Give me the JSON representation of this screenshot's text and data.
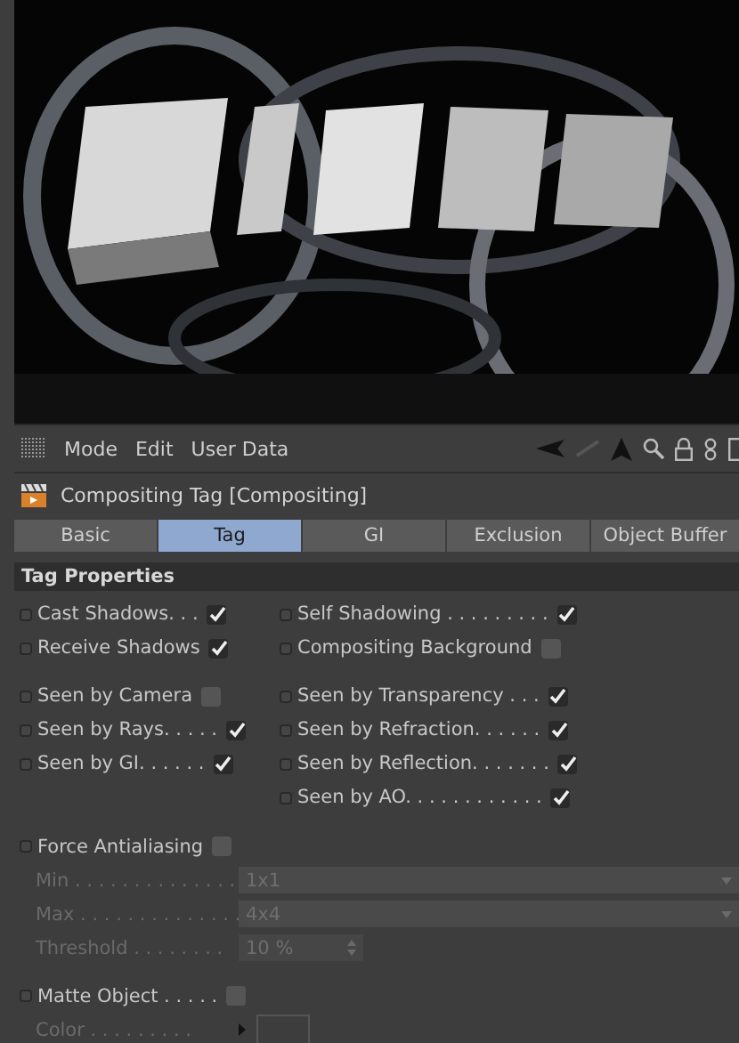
{
  "viewport": {
    "kind": "picture"
  },
  "menu": [
    "Mode",
    "Edit",
    "User Data"
  ],
  "title": "Compositing Tag [Compositing]",
  "tabs": [
    {
      "label": "Basic",
      "selected": false
    },
    {
      "label": "Tag",
      "selected": true
    },
    {
      "label": "GI",
      "selected": false
    },
    {
      "label": "Exclusion",
      "selected": false
    },
    {
      "label": "Object Buffer",
      "selected": false
    }
  ],
  "section": "Tag Properties",
  "groups": [
    [
      {
        "left": {
          "label": "Cast Shadows. . .",
          "checked": true
        },
        "right": {
          "label": "Self Shadowing . . . . . . . . .",
          "checked": true
        }
      },
      {
        "left": {
          "label": "Receive Shadows",
          "checked": true
        },
        "right": {
          "label": "Compositing Background",
          "checked": false
        }
      }
    ],
    [
      {
        "left": {
          "label": "Seen by Camera",
          "checked": false
        },
        "right": {
          "label": "Seen by Transparency . . .",
          "checked": true
        }
      },
      {
        "left": {
          "label": "Seen by Rays. . . . .",
          "checked": true
        },
        "right": {
          "label": "Seen by Refraction. . . . . .",
          "checked": true
        }
      },
      {
        "left": {
          "label": "Seen by GI. . . . . .",
          "checked": true
        },
        "right": {
          "label": "Seen by Reflection. . . . . . .",
          "checked": true
        }
      },
      {
        "right": {
          "label": "Seen by AO. . . . . . . . . . . .",
          "checked": true
        }
      }
    ]
  ],
  "antialiasing": {
    "label": "Force Antialiasing",
    "checked": false
  },
  "fields": [
    {
      "label": "Min . . . . . . . . . . . . . .",
      "value": "1x1",
      "kind": "dropdown",
      "disabled": true
    },
    {
      "label": "Max . . . . . . . . . . . . . .",
      "value": "4x4",
      "kind": "dropdown",
      "disabled": true
    },
    {
      "label": "Threshold . . . . . . . .",
      "value": "10 %",
      "kind": "number",
      "disabled": true
    }
  ],
  "matte": {
    "label": "Matte Object . . . . .",
    "checked": false
  },
  "color": {
    "label": "Color . . . . . . . . ."
  }
}
